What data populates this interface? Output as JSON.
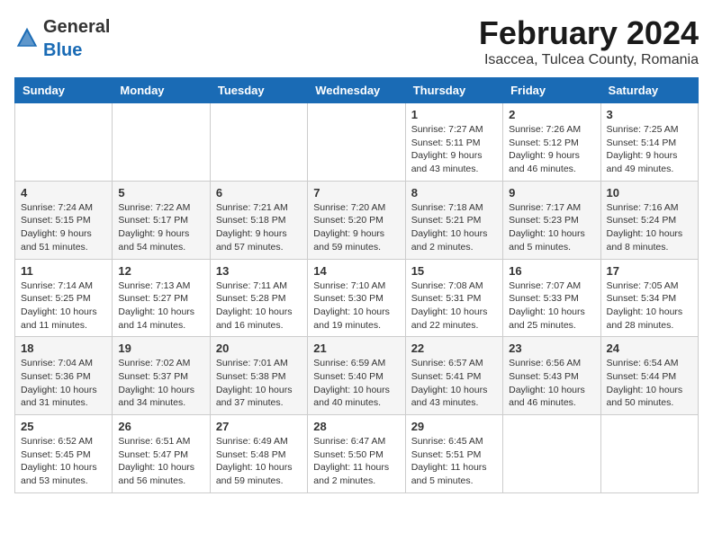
{
  "header": {
    "logo_general": "General",
    "logo_blue": "Blue",
    "month_title": "February 2024",
    "location": "Isaccea, Tulcea County, Romania"
  },
  "columns": [
    "Sunday",
    "Monday",
    "Tuesday",
    "Wednesday",
    "Thursday",
    "Friday",
    "Saturday"
  ],
  "weeks": [
    [
      {
        "day": "",
        "info": ""
      },
      {
        "day": "",
        "info": ""
      },
      {
        "day": "",
        "info": ""
      },
      {
        "day": "",
        "info": ""
      },
      {
        "day": "1",
        "info": "Sunrise: 7:27 AM\nSunset: 5:11 PM\nDaylight: 9 hours\nand 43 minutes."
      },
      {
        "day": "2",
        "info": "Sunrise: 7:26 AM\nSunset: 5:12 PM\nDaylight: 9 hours\nand 46 minutes."
      },
      {
        "day": "3",
        "info": "Sunrise: 7:25 AM\nSunset: 5:14 PM\nDaylight: 9 hours\nand 49 minutes."
      }
    ],
    [
      {
        "day": "4",
        "info": "Sunrise: 7:24 AM\nSunset: 5:15 PM\nDaylight: 9 hours\nand 51 minutes."
      },
      {
        "day": "5",
        "info": "Sunrise: 7:22 AM\nSunset: 5:17 PM\nDaylight: 9 hours\nand 54 minutes."
      },
      {
        "day": "6",
        "info": "Sunrise: 7:21 AM\nSunset: 5:18 PM\nDaylight: 9 hours\nand 57 minutes."
      },
      {
        "day": "7",
        "info": "Sunrise: 7:20 AM\nSunset: 5:20 PM\nDaylight: 9 hours\nand 59 minutes."
      },
      {
        "day": "8",
        "info": "Sunrise: 7:18 AM\nSunset: 5:21 PM\nDaylight: 10 hours\nand 2 minutes."
      },
      {
        "day": "9",
        "info": "Sunrise: 7:17 AM\nSunset: 5:23 PM\nDaylight: 10 hours\nand 5 minutes."
      },
      {
        "day": "10",
        "info": "Sunrise: 7:16 AM\nSunset: 5:24 PM\nDaylight: 10 hours\nand 8 minutes."
      }
    ],
    [
      {
        "day": "11",
        "info": "Sunrise: 7:14 AM\nSunset: 5:25 PM\nDaylight: 10 hours\nand 11 minutes."
      },
      {
        "day": "12",
        "info": "Sunrise: 7:13 AM\nSunset: 5:27 PM\nDaylight: 10 hours\nand 14 minutes."
      },
      {
        "day": "13",
        "info": "Sunrise: 7:11 AM\nSunset: 5:28 PM\nDaylight: 10 hours\nand 16 minutes."
      },
      {
        "day": "14",
        "info": "Sunrise: 7:10 AM\nSunset: 5:30 PM\nDaylight: 10 hours\nand 19 minutes."
      },
      {
        "day": "15",
        "info": "Sunrise: 7:08 AM\nSunset: 5:31 PM\nDaylight: 10 hours\nand 22 minutes."
      },
      {
        "day": "16",
        "info": "Sunrise: 7:07 AM\nSunset: 5:33 PM\nDaylight: 10 hours\nand 25 minutes."
      },
      {
        "day": "17",
        "info": "Sunrise: 7:05 AM\nSunset: 5:34 PM\nDaylight: 10 hours\nand 28 minutes."
      }
    ],
    [
      {
        "day": "18",
        "info": "Sunrise: 7:04 AM\nSunset: 5:36 PM\nDaylight: 10 hours\nand 31 minutes."
      },
      {
        "day": "19",
        "info": "Sunrise: 7:02 AM\nSunset: 5:37 PM\nDaylight: 10 hours\nand 34 minutes."
      },
      {
        "day": "20",
        "info": "Sunrise: 7:01 AM\nSunset: 5:38 PM\nDaylight: 10 hours\nand 37 minutes."
      },
      {
        "day": "21",
        "info": "Sunrise: 6:59 AM\nSunset: 5:40 PM\nDaylight: 10 hours\nand 40 minutes."
      },
      {
        "day": "22",
        "info": "Sunrise: 6:57 AM\nSunset: 5:41 PM\nDaylight: 10 hours\nand 43 minutes."
      },
      {
        "day": "23",
        "info": "Sunrise: 6:56 AM\nSunset: 5:43 PM\nDaylight: 10 hours\nand 46 minutes."
      },
      {
        "day": "24",
        "info": "Sunrise: 6:54 AM\nSunset: 5:44 PM\nDaylight: 10 hours\nand 50 minutes."
      }
    ],
    [
      {
        "day": "25",
        "info": "Sunrise: 6:52 AM\nSunset: 5:45 PM\nDaylight: 10 hours\nand 53 minutes."
      },
      {
        "day": "26",
        "info": "Sunrise: 6:51 AM\nSunset: 5:47 PM\nDaylight: 10 hours\nand 56 minutes."
      },
      {
        "day": "27",
        "info": "Sunrise: 6:49 AM\nSunset: 5:48 PM\nDaylight: 10 hours\nand 59 minutes."
      },
      {
        "day": "28",
        "info": "Sunrise: 6:47 AM\nSunset: 5:50 PM\nDaylight: 11 hours\nand 2 minutes."
      },
      {
        "day": "29",
        "info": "Sunrise: 6:45 AM\nSunset: 5:51 PM\nDaylight: 11 hours\nand 5 minutes."
      },
      {
        "day": "",
        "info": ""
      },
      {
        "day": "",
        "info": ""
      }
    ]
  ]
}
